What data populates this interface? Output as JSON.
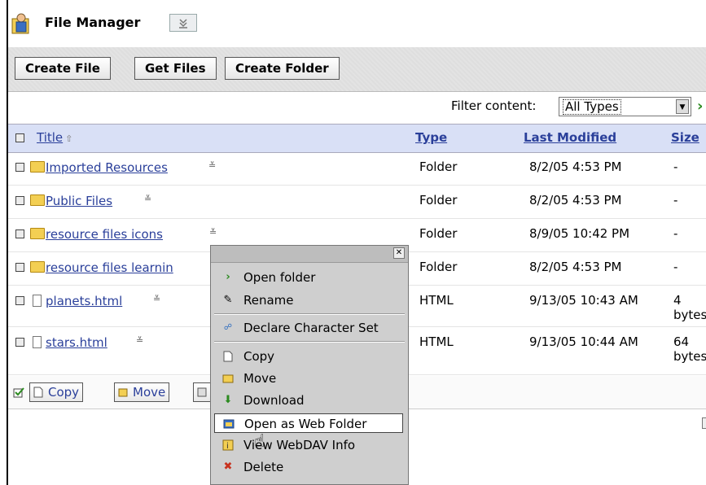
{
  "app": {
    "title": "File Manager"
  },
  "toolbar": {
    "create_file": "Create File",
    "get_files": "Get Files",
    "create_folder": "Create Folder"
  },
  "filter": {
    "label": "Filter content:",
    "selected": "All Types"
  },
  "columns": {
    "title": "Title",
    "type": "Type",
    "last_modified": "Last Modified",
    "size": "Size"
  },
  "rows": [
    {
      "name": "Imported Resources",
      "kind": "folder",
      "type": "Folder",
      "modified": "8/2/05 4:53 PM",
      "size": "-"
    },
    {
      "name": "Public Files",
      "kind": "folder",
      "type": "Folder",
      "modified": "8/2/05 4:53 PM",
      "size": "-"
    },
    {
      "name": "resource files icons",
      "kind": "folder",
      "type": "Folder",
      "modified": "8/9/05 10:42 PM",
      "size": "-"
    },
    {
      "name": "resource files learnin",
      "kind": "folder",
      "type": "Folder",
      "modified": "8/2/05 4:53 PM",
      "size": "-"
    },
    {
      "name": "planets.html",
      "kind": "file",
      "type": "HTML",
      "modified": "9/13/05 10:43 AM",
      "size": "4 bytes"
    },
    {
      "name": "stars.html",
      "kind": "file",
      "type": "HTML",
      "modified": "9/13/05 10:44 AM",
      "size": "64 bytes"
    }
  ],
  "bottom": {
    "copy": "Copy",
    "move": "Move"
  },
  "context_menu": {
    "open_folder": "Open folder",
    "rename": "Rename",
    "declare_charset": "Declare Character Set",
    "copy": "Copy",
    "move": "Move",
    "download": "Download",
    "open_web_folder": "Open as Web Folder",
    "view_webdav": "View WebDAV Info",
    "delete": "Delete"
  },
  "icons": {
    "app": "user-folder-icon",
    "menu": "menu-chevron-icon",
    "go": "go-arrow-icon",
    "sort": "sort-ascending-icon"
  },
  "colors": {
    "link": "#2a3f9a",
    "header_bg": "#d9e0f6",
    "go_arrow": "#2b8a1f"
  }
}
